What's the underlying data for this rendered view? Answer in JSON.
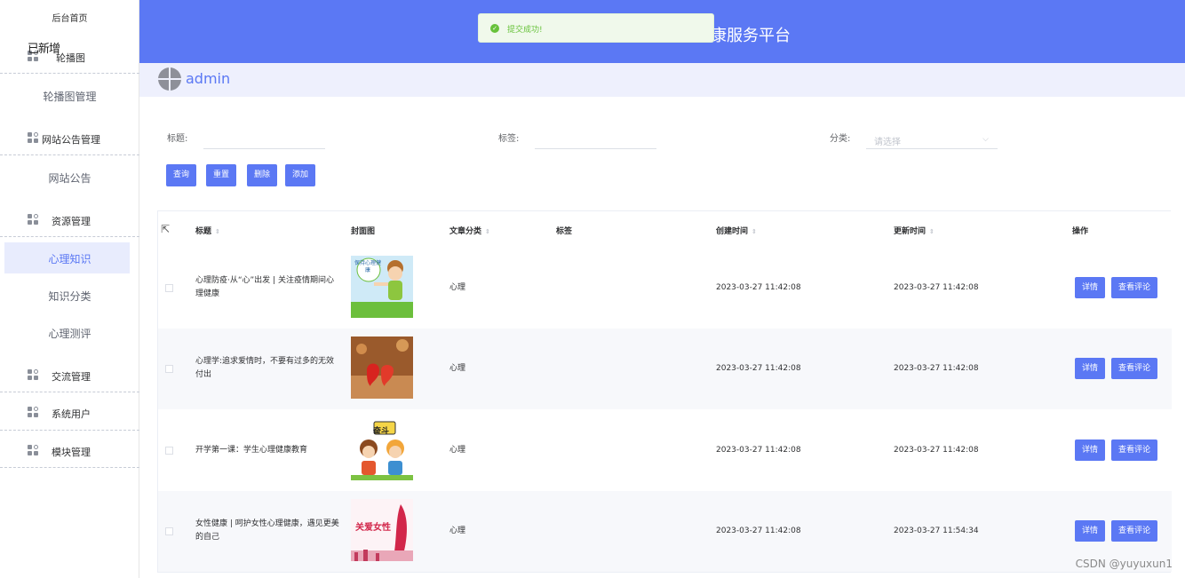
{
  "sidebar": {
    "home": "后台首页",
    "overlap_text": "已新增",
    "groups": [
      {
        "label": "轮播图",
        "icon": "grid-icon"
      },
      {
        "label": "网站公告管理",
        "icon": "grid-icon"
      },
      {
        "label": "资源管理",
        "icon": "grid-icon"
      },
      {
        "label": "交流管理",
        "icon": "grid-icon"
      },
      {
        "label": "系统用户",
        "icon": "grid-icon"
      },
      {
        "label": "模块管理",
        "icon": "grid-icon"
      }
    ],
    "subs": {
      "carousel": "轮播图管理",
      "notice": "网站公告",
      "knowledge": "心理知识",
      "category": "知识分类",
      "assessment": "心理测评"
    },
    "active_item": "心理知识"
  },
  "header": {
    "title": "康服务平台",
    "background": "#5b78f4"
  },
  "toast": {
    "message": "提交成功!",
    "type": "success",
    "color": "#67c23a"
  },
  "user": {
    "name": "admin"
  },
  "filters": {
    "title_label": "标题:",
    "title_value": "",
    "tag_label": "标签:",
    "tag_value": "",
    "category_label": "分类:",
    "category_placeholder": "请选择"
  },
  "buttons": {
    "query": "查询",
    "reset": "重置",
    "delete": "删除",
    "add": "添加"
  },
  "table": {
    "headers": {
      "title": "标题",
      "cover": "封面图",
      "category": "文章分类",
      "tags": "标签",
      "created": "创建时间",
      "updated": "更新时间",
      "actions": "操作"
    },
    "rows": [
      {
        "title": "心理防疫·从“心”出发 | 关注疫情期间心理健康",
        "category": "心理",
        "tags": "",
        "created": "2023-03-27 11:42:08",
        "updated": "2023-03-27 11:42:08",
        "cover_text": "保持心理健康"
      },
      {
        "title": "心理学:追求爱情时，不要有过多的无效付出",
        "category": "心理",
        "tags": "",
        "created": "2023-03-27 11:42:08",
        "updated": "2023-03-27 11:42:08",
        "cover_text": ""
      },
      {
        "title": "开学第一课：学生心理健康教育",
        "category": "心理",
        "tags": "",
        "created": "2023-03-27 11:42:08",
        "updated": "2023-03-27 11:42:08",
        "cover_text": "奋斗"
      },
      {
        "title": "女性健康 | 呵护女性心理健康，遇见更美的自己",
        "category": "心理",
        "tags": "",
        "created": "2023-03-27 11:42:08",
        "updated": "2023-03-27 11:54:34",
        "cover_text": "关爱女性"
      }
    ],
    "row_actions": {
      "detail": "详情",
      "comments": "查看评论"
    }
  },
  "watermark": "CSDN @yuyuxun1"
}
